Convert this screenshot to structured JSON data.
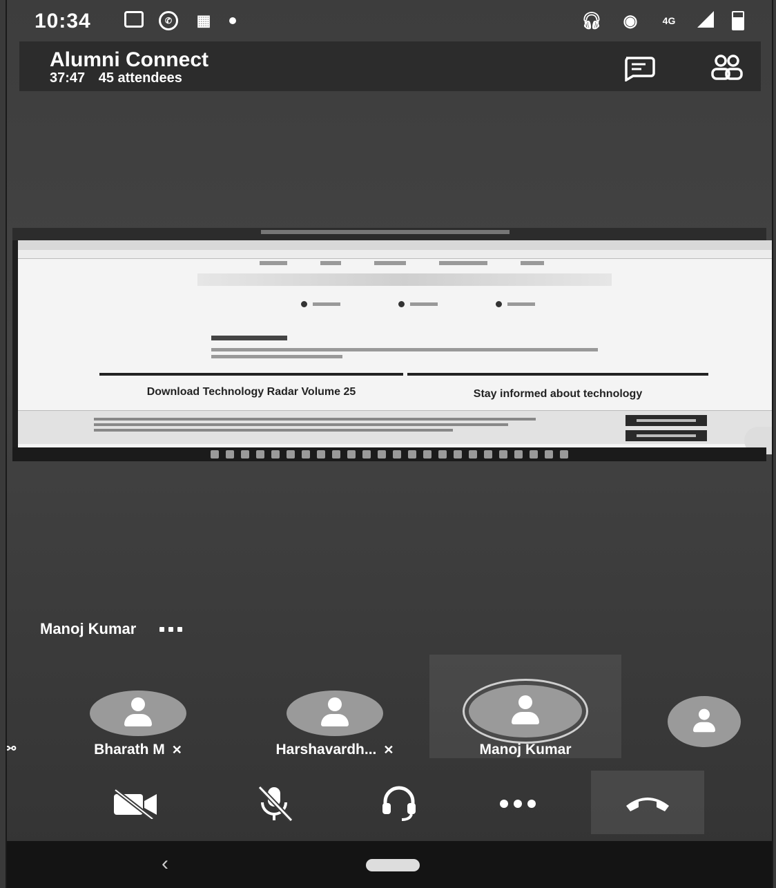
{
  "status_bar": {
    "time": "10:34",
    "network_label": "4G"
  },
  "header": {
    "meeting_title": "Alumni Connect",
    "duration": "37:47",
    "attendees": "45 attendees"
  },
  "shared_screen": {
    "headline_left": "Download Technology Radar Volume 25",
    "headline_right": "Stay informed about technology"
  },
  "presenter": {
    "name": "Manoj Kumar"
  },
  "participants": [
    {
      "name": "Bharath M",
      "muted": true
    },
    {
      "name": "Harshavardh...",
      "muted": true
    },
    {
      "name": "Manoj Kumar",
      "muted": false,
      "active": true
    }
  ],
  "controls": {
    "camera": "camera-off-icon",
    "mic": "mic-off-icon",
    "audio": "headset-icon",
    "more": "more-icon",
    "hangup": "hang-up-icon"
  },
  "colors": {
    "background": "#3d3d3d",
    "avatar": "#9a9a9a",
    "text": "#ffffff"
  }
}
